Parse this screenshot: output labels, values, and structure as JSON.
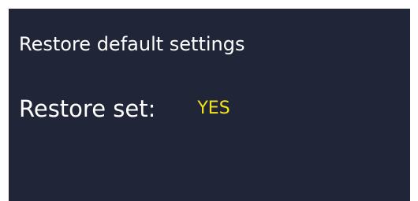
{
  "dialog": {
    "title": "Restore default settings",
    "setting": {
      "label": "Restore set:",
      "value": "YES"
    }
  },
  "colors": {
    "background": "#212538",
    "text": "#ffffff",
    "value": "#f4e21b"
  }
}
